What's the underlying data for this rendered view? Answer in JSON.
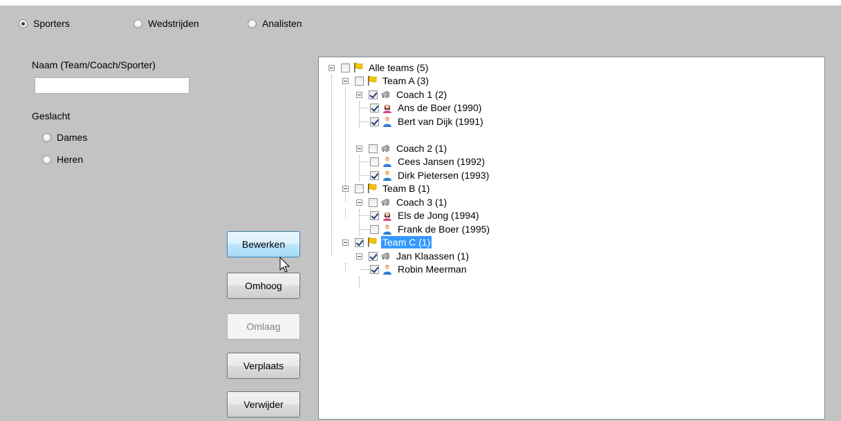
{
  "view_options": [
    {
      "label": "Sporters",
      "checked": true
    },
    {
      "label": "Wedstrijden",
      "checked": false
    },
    {
      "label": "Analisten",
      "checked": false
    }
  ],
  "form": {
    "name_label": "Naam (Team/Coach/Sporter)",
    "name_value": "",
    "gender_label": "Geslacht",
    "gender_options": [
      {
        "label": "Dames",
        "checked": false
      },
      {
        "label": "Heren",
        "checked": false
      }
    ]
  },
  "buttons": {
    "edit": "Bewerken",
    "up": "Omhoog",
    "down": "Omlaag",
    "move": "Verplaats",
    "remove": "Verwijder"
  },
  "tree": [
    {
      "label": "Alle teams (5)",
      "type": "flag",
      "checked": false
    },
    {
      "label": "Team A (3)",
      "type": "flag",
      "checked": false
    },
    {
      "label": "Coach 1 (2)",
      "type": "coach",
      "checked": true
    },
    {
      "label": "Ans de Boer (1990)",
      "type": "female",
      "checked": true
    },
    {
      "label": "Bert van Dijk (1991)",
      "type": "male",
      "checked": true
    },
    {
      "label": "Coach 2 (1)",
      "type": "coach",
      "checked": false
    },
    {
      "label": "Cees Jansen (1992)",
      "type": "male",
      "checked": false
    },
    {
      "label": "Dirk Pietersen (1993)",
      "type": "male",
      "checked": true
    },
    {
      "label": "Team B (1)",
      "type": "flag",
      "checked": false
    },
    {
      "label": "Coach 3 (1)",
      "type": "coach",
      "checked": false
    },
    {
      "label": "Els de Jong (1994)",
      "type": "female",
      "checked": true
    },
    {
      "label": "Frank de Boer (1995)",
      "type": "male",
      "checked": false
    },
    {
      "label": "Team C (1)",
      "type": "flag",
      "checked": true,
      "selected": true
    },
    {
      "label": "Jan Klaassen (1)",
      "type": "coach",
      "checked": true
    },
    {
      "label": "Robin Meerman",
      "type": "male",
      "checked": true
    }
  ],
  "colors": {
    "background": "#c3c3c3",
    "selection": "#3399ff",
    "hover_border": "#3c7fb1"
  }
}
